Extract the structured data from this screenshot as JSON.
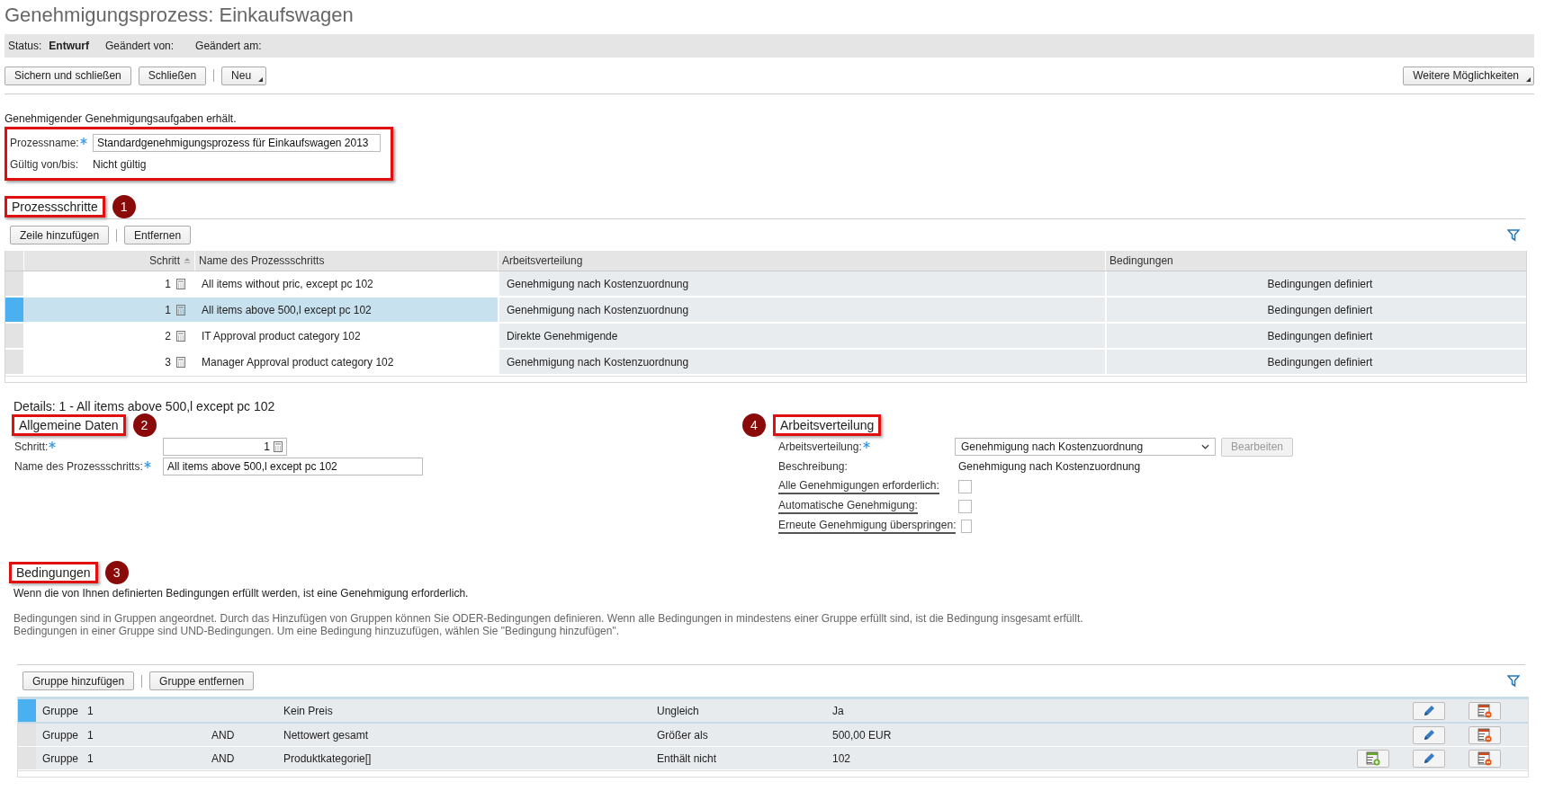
{
  "title": "Genehmigungsprozess: Einkaufswagen",
  "status_bar": {
    "status_label": "Status:",
    "status_value": "Entwurf",
    "changed_by_label": "Geändert von:",
    "changed_at_label": "Geändert am:"
  },
  "toolbar": {
    "button_groups": [
      [
        {
          "label": "Sichern und schließen",
          "menu": false
        },
        {
          "label": "Schließen",
          "menu": false
        }
      ],
      [
        {
          "label": "Neu",
          "menu": true
        }
      ]
    ],
    "more_button": {
      "label": "Weitere Möglichkeiten",
      "menu": true
    }
  },
  "intro": "Genehmigender Genehmigungsaufgaben erhält.",
  "header_fields": {
    "process_name": {
      "label": "Prozessname:",
      "required": true,
      "value": "Standardgenehmigungsprozess für Einkaufswagen 2013"
    },
    "validity": {
      "label": "Gültig von/bis:",
      "value": "Nicht gültig"
    }
  },
  "steps_section": {
    "heading": "Prozessschritte",
    "badge": "1",
    "buttons": [
      "Zeile hinzufügen",
      "Entfernen"
    ],
    "columns": [
      "Schritt",
      "Name des Prozessschritts",
      "Arbeitsverteilung",
      "Bedingungen"
    ],
    "rows": [
      {
        "step": "1",
        "name": "All items without pric, except pc 102",
        "distribution": "Genehmigung nach Kostenzuordnung",
        "conditions": "Bedingungen definiert",
        "selected": false
      },
      {
        "step": "1",
        "name": "All items above 500,l except pc 102",
        "distribution": "Genehmigung nach Kostenzuordnung",
        "conditions": "Bedingungen definiert",
        "selected": true
      },
      {
        "step": "2",
        "name": "IT Approval product category 102",
        "distribution": "Direkte Genehmigende",
        "conditions": "Bedingungen definiert",
        "selected": false
      },
      {
        "step": "3",
        "name": "Manager Approval product category 102",
        "distribution": "Genehmigung nach Kostenzuordnung",
        "conditions": "Bedingungen definiert",
        "selected": false
      }
    ]
  },
  "details": {
    "title": "Details: 1 - All items above 500,l except pc 102"
  },
  "general_data": {
    "heading": "Allgemeine Daten",
    "badge": "2",
    "fields": [
      {
        "label": "Schritt:",
        "required": true,
        "value": "1",
        "kind": "stepper"
      },
      {
        "label": "Name des Prozessschritts:",
        "required": true,
        "value": "All items above 500,l except pc 102",
        "kind": "text"
      }
    ]
  },
  "distribution": {
    "heading": "Arbeitsverteilung",
    "badge": "4",
    "select": {
      "label": "Arbeitsverteilung:",
      "required": true,
      "value": "Genehmigung nach Kostenzuordnung"
    },
    "edit_button": {
      "label": "Bearbeiten",
      "disabled": true
    },
    "description": {
      "label": "Beschreibung:",
      "value": "Genehmigung nach Kostenzuordnung"
    },
    "options": [
      {
        "label": "Alle Genehmigungen erforderlich:",
        "checked": false
      },
      {
        "label": "Automatische Genehmigung:",
        "checked": false
      },
      {
        "label": "Erneute Genehmigung überspringen:",
        "checked": false
      }
    ]
  },
  "conditions": {
    "heading": "Bedingungen",
    "badge": "3",
    "summary": "Wenn die von Ihnen definierten Bedingungen erfüllt werden, ist eine Genehmigung erforderlich.",
    "help_lines": [
      "Bedingungen sind in Gruppen angeordnet. Durch das Hinzufügen von Gruppen können Sie ODER-Bedingungen definieren. Wenn alle Bedingungen in mindestens einer Gruppe erfüllt sind, ist die Bedingung insgesamt erfüllt.",
      "Bedingungen in einer Gruppe sind UND-Bedingungen. Um eine Bedingung hinzuzufügen, wählen Sie \"Bedingung hinzufügen\"."
    ],
    "buttons": [
      "Gruppe hinzufügen",
      "Gruppe entfernen"
    ],
    "rows": [
      {
        "group": "Gruppe",
        "group_no": "1",
        "attribute": "Kein Preis",
        "operator": "Ungleich",
        "value": "Ja",
        "selected": true,
        "actions": [
          {
            "kind": "edit"
          },
          {
            "kind": "delete"
          }
        ]
      },
      {
        "group": "Gruppe",
        "group_no": "1",
        "connector": "AND",
        "attribute": "Nettowert gesamt",
        "operator": "Größer als",
        "value": "500,00 EUR",
        "selected": false,
        "actions": [
          {
            "kind": "edit"
          },
          {
            "kind": "delete"
          }
        ]
      },
      {
        "group": "Gruppe",
        "group_no": "1",
        "connector": "AND",
        "attribute": "Produktkategorie[]",
        "operator": "Enthält nicht",
        "value": "102",
        "selected": false,
        "actions": [
          {
            "kind": "add"
          },
          {
            "kind": "edit"
          },
          {
            "kind": "delete"
          }
        ]
      }
    ]
  }
}
